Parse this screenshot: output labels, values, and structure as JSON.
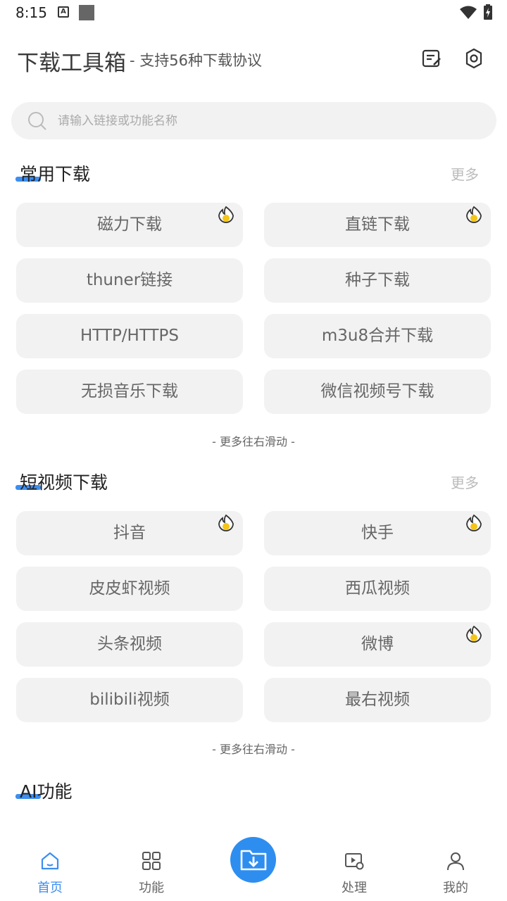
{
  "status_bar": {
    "time": "8:15",
    "a_badge": "A"
  },
  "header": {
    "title": "下载工具箱",
    "subtitle": "- 支持56种下载协议"
  },
  "search": {
    "placeholder": "请输入链接或功能名称"
  },
  "sections": [
    {
      "title": "常用下载",
      "more": "更多",
      "items": [
        {
          "label": "磁力下载",
          "hot": true
        },
        {
          "label": "直链下载",
          "hot": true
        },
        {
          "label": "thuner链接",
          "hot": false
        },
        {
          "label": "种子下载",
          "hot": false
        },
        {
          "label": "HTTP/HTTPS",
          "hot": false
        },
        {
          "label": "m3u8合并下载",
          "hot": false
        },
        {
          "label": "无损音乐下载",
          "hot": false
        },
        {
          "label": "微信视频号下载",
          "hot": false
        }
      ],
      "hint": "- 更多往右滑动 -"
    },
    {
      "title": "短视频下载",
      "more": "更多",
      "items": [
        {
          "label": "抖音",
          "hot": true
        },
        {
          "label": "快手",
          "hot": true
        },
        {
          "label": "皮皮虾视频",
          "hot": false
        },
        {
          "label": "西瓜视频",
          "hot": false
        },
        {
          "label": "头条视频",
          "hot": false
        },
        {
          "label": "微博",
          "hot": true
        },
        {
          "label": "bilibili视频",
          "hot": false
        },
        {
          "label": "最右视频",
          "hot": false
        }
      ],
      "hint": "- 更多往右滑动 -"
    },
    {
      "title": "AI功能"
    }
  ],
  "nav": {
    "home": "首页",
    "features": "功能",
    "process": "处理",
    "mine": "我的"
  },
  "colors": {
    "accent": "#3d8ef0",
    "hot": "#f5c518"
  }
}
